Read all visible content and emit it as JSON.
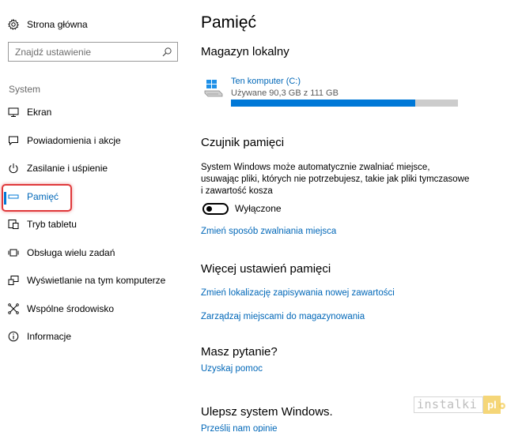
{
  "sidebar": {
    "home_label": "Strona główna",
    "search_placeholder": "Znajdź ustawienie",
    "section_title": "System",
    "items": [
      {
        "label": "Ekran",
        "icon": "monitor-icon"
      },
      {
        "label": "Powiadomienia i akcje",
        "icon": "notification-icon"
      },
      {
        "label": "Zasilanie i uśpienie",
        "icon": "power-icon"
      },
      {
        "label": "Pamięć",
        "icon": "storage-icon",
        "selected": true
      },
      {
        "label": "Tryb tabletu",
        "icon": "tablet-icon"
      },
      {
        "label": "Obsługa wielu zadań",
        "icon": "multitasking-icon"
      },
      {
        "label": "Wyświetlanie na tym komputerze",
        "icon": "project-icon"
      },
      {
        "label": "Wspólne środowisko",
        "icon": "shared-icon"
      },
      {
        "label": "Informacje",
        "icon": "info-icon"
      }
    ]
  },
  "main": {
    "title": "Pamięć",
    "local_storage": {
      "heading": "Magazyn lokalny",
      "drive_name": "Ten komputer (C:)",
      "drive_usage": "Używane 90,3 GB z 111 GB",
      "used_fraction": 0.8135
    },
    "sensor": {
      "heading": "Czujnik pamięci",
      "description": "System Windows może automatycznie zwalniać miejsce, usuwając pliki, których nie potrzebujesz, takie jak pliki tymczasowe i zawartość kosza",
      "toggle_state": "Wyłączone",
      "toggle_on": false,
      "link": "Zmień sposób zwalniania miejsca"
    },
    "more": {
      "heading": "Więcej ustawień pamięci",
      "link1": "Zmień lokalizację zapisywania nowej zawartości",
      "link2": "Zarządzaj miejscami do magazynowania"
    },
    "question": {
      "heading": "Masz pytanie?",
      "link": "Uzyskaj pomoc"
    },
    "improve": {
      "heading": "Ulepsz system Windows.",
      "link": "Prześlij nam opinie"
    }
  },
  "watermark": {
    "text": "instalki",
    "suffix": "pl"
  },
  "colors": {
    "accent": "#0078d7",
    "link": "#0067b8",
    "highlight_border": "#e0393b",
    "progress_bg": "#cccccc"
  }
}
